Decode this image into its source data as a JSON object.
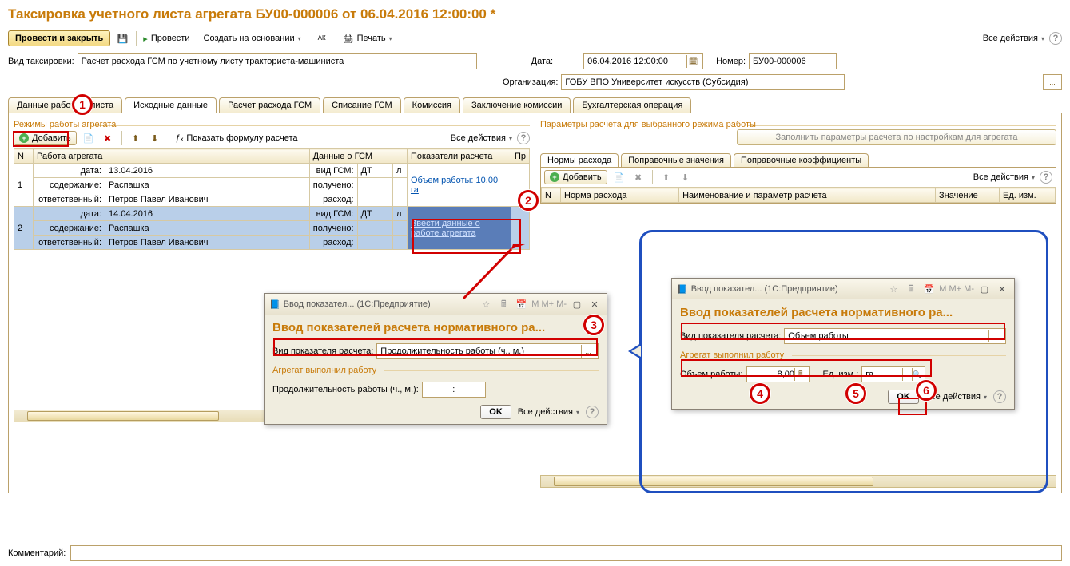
{
  "title": "Таксировка учетного листа агрегата БУ00-000006 от 06.04.2016 12:00:00 *",
  "cmdbar": {
    "provesti_zakryt": "Провести и закрыть",
    "provesti": "Провести",
    "sozdat": "Создать на основании",
    "pechat": "Печать",
    "all_actions": "Все действия"
  },
  "form": {
    "vid_label": "Вид таксировки:",
    "vid_value": "Расчет расхода ГСМ по учетному листу тракториста-машиниста",
    "date_label": "Дата:",
    "date_value": "06.04.2016 12:00:00",
    "number_label": "Номер:",
    "number_value": "БУ00-000006",
    "org_label": "Организация:",
    "org_value": "ГОБУ ВПО Университет искусств (Субсидия)"
  },
  "tabs": [
    "Данные рабочего листа",
    "Исходные данные",
    "Расчет расхода ГСМ",
    "Списание ГСМ",
    "Комиссия",
    "Заключение комиссии",
    "Бухгалтерская операция"
  ],
  "active_tab": 1,
  "left": {
    "group": "Режимы работы агрегата",
    "add": "Добавить",
    "show_formula": "Показать формулу расчета",
    "all_actions": "Все действия",
    "cols": {
      "n": "N",
      "work": "Работа агрегата",
      "gsm": "Данные о ГСМ",
      "calc": "Показатели расчета",
      "pr": "Пр"
    },
    "r1": {
      "n": "1",
      "date_l": "дата:",
      "date": "13.04.2016",
      "sod_l": "содержание:",
      "sod": "Распашка",
      "resp_l": "ответственный:",
      "resp": "Петров Павел Иванович",
      "gsm_l": "вид ГСМ:",
      "gsm": "ДТ",
      "l": "л",
      "pol_l": "получено:",
      "ras_l": "расход:",
      "calc": "Объем работы: 10,00 га"
    },
    "r2": {
      "n": "2",
      "date_l": "дата:",
      "date": "14.04.2016",
      "sod_l": "содержание:",
      "sod": "Распашка",
      "resp_l": "ответственный:",
      "resp": "Петров Павел Иванович",
      "gsm_l": "вид ГСМ:",
      "gsm": "ДТ",
      "l": "л",
      "pol_l": "получено:",
      "ras_l": "расход:",
      "calc": "Ввести данные о работе агрегата"
    }
  },
  "right": {
    "group": "Параметры расчета для выбранного режима работы",
    "fill_btn": "Заполнить параметры расчета по настройкам для агрегата",
    "subtabs": [
      "Нормы расхода",
      "Поправочные значения",
      "Поправочные коэффициенты"
    ],
    "active": 0,
    "add": "Добавить",
    "all_actions": "Все действия",
    "cols": {
      "n": "N",
      "norm": "Норма расхода",
      "name": "Наименование и параметр расчета",
      "val": "Значение",
      "unit": "Ед. изм."
    }
  },
  "modal_left": {
    "wintitle": "Ввод показател... (1С:Предприятие)",
    "h1": "Ввод показателей расчета нормативного ра...",
    "vid_label": "Вид показателя расчета:",
    "vid_value": "Продолжительность работы (ч., м.)",
    "agr_label": "Агрегат выполнил работу",
    "prod_label": "Продолжительность работы (ч., м.):",
    "prod_value": ":",
    "ok": "OK",
    "all_actions": "Все действия"
  },
  "modal_right": {
    "wintitle": "Ввод показател... (1С:Предприятие)",
    "h1": "Ввод показателей расчета нормативного ра...",
    "vid_label": "Вид показателя расчета:",
    "vid_value": "Объем работы",
    "agr_label": "Агрегат выполнил работу",
    "vol_label": "Объем работы:",
    "vol_value": "8,00",
    "unit_label": "Ед. изм.:",
    "unit_value": "га",
    "ok": "OK",
    "all_actions": "Все действия"
  },
  "comment_label": "Комментарий:"
}
